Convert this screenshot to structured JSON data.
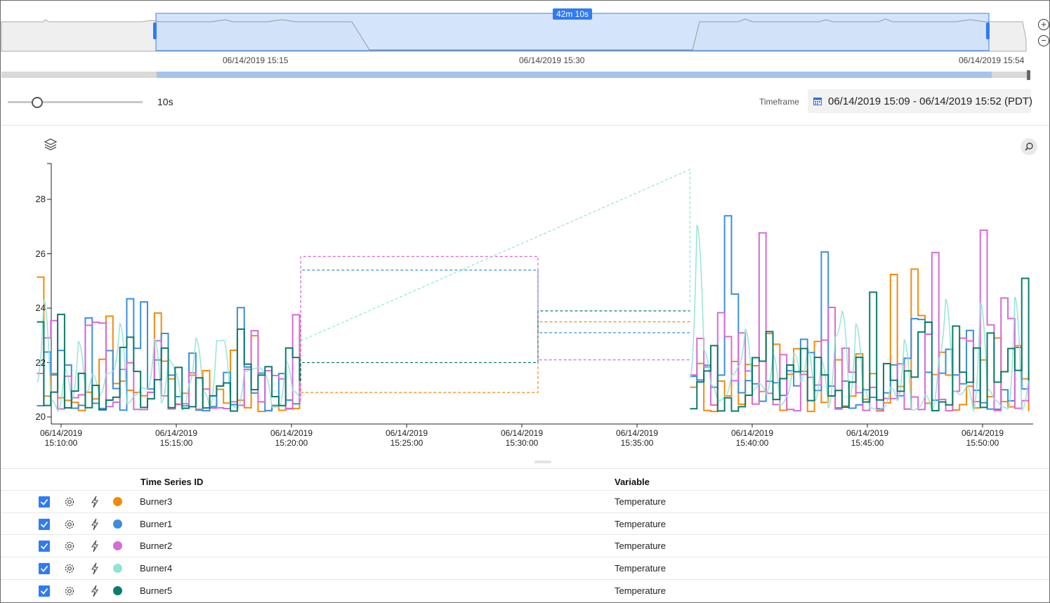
{
  "brush": {
    "duration_badge": "42m 10s",
    "labels": [
      "06/14/2019 15:15",
      "06/14/2019 15:30",
      "06/14/2019 15:54"
    ],
    "zoom_in_icon": "plus-circle-icon",
    "zoom_out_icon": "minus-circle-icon"
  },
  "controls": {
    "interval_value": "10s",
    "timeframe_label": "Timeframe",
    "timeframe_value": "06/14/2019 15:09 - 06/14/2019 15:52 (PDT)",
    "calendar_icon": "calendar-icon",
    "layers_icon": "layers-icon",
    "search_icon": "search-icon"
  },
  "chart_data": {
    "type": "line",
    "x_ticks": [
      "06/14/2019 15:10:00",
      "06/14/2019 15:15:00",
      "06/14/2019 15:20:00",
      "06/14/2019 15:25:00",
      "06/14/2019 15:30:00",
      "06/14/2019 15:35:00",
      "06/14/2019 15:40:00",
      "06/14/2019 15:45:00",
      "06/14/2019 15:50:00"
    ],
    "y_ticks": [
      "20",
      "22",
      "24",
      "26",
      "28"
    ],
    "ylim": [
      19.7,
      29.3
    ],
    "xlim_minutes_after_15_10": [
      -1,
      42.5
    ],
    "step_style": true,
    "gap_minutes": [
      20.7,
      37.2
    ],
    "series": [
      {
        "name": "Burner3",
        "color": "#f28a0c",
        "gap_values": [
          20.9,
          23.5
        ],
        "end_value": 20.5
      },
      {
        "name": "Burner1",
        "color": "#3a8fdd",
        "gap_values": [
          25.4,
          23.1
        ],
        "end_value": 21.7
      },
      {
        "name": "Burner2",
        "color": "#d96ad4",
        "gap_values": [
          25.9,
          22.1
        ],
        "end_value": 23.4
      },
      {
        "name": "Burner4",
        "color": "#8fe3d6",
        "gap_values": [
          22.8,
          29.1
        ],
        "end_value": 21.0
      },
      {
        "name": "Burner5",
        "color": "#0a7d6a",
        "gap_values": [
          22.0,
          23.9
        ],
        "end_value": 20.3
      }
    ]
  },
  "table": {
    "headers": {
      "id": "Time Series ID",
      "variable": "Variable"
    },
    "rows": [
      {
        "id": "Burner3",
        "variable": "Temperature",
        "color": "#f28a0c"
      },
      {
        "id": "Burner1",
        "variable": "Temperature",
        "color": "#3a8fdd"
      },
      {
        "id": "Burner2",
        "variable": "Temperature",
        "color": "#d96ad4"
      },
      {
        "id": "Burner4",
        "variable": "Temperature",
        "color": "#8fe3d6"
      },
      {
        "id": "Burner5",
        "variable": "Temperature",
        "color": "#0a7d6a"
      }
    ],
    "row_icons": [
      "checkbox-icon",
      "gear-icon",
      "lightning-icon",
      "color-dot-icon"
    ]
  }
}
